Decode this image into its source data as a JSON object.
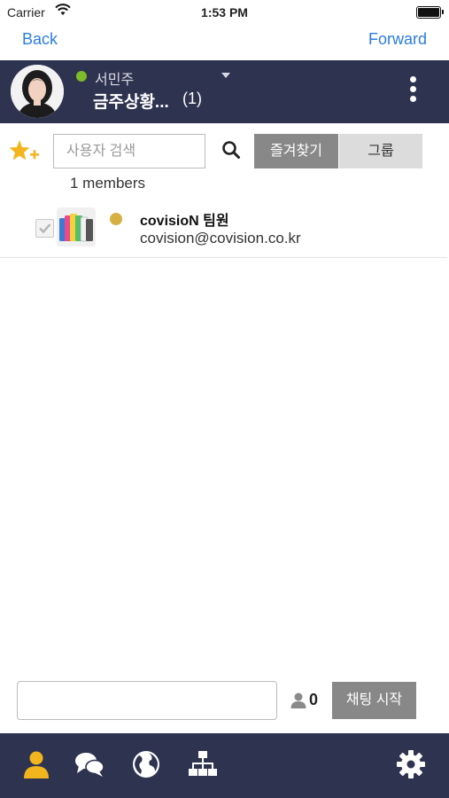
{
  "status_bar": {
    "carrier": "Carrier",
    "time": "1:53 PM"
  },
  "nav": {
    "back_label": "Back",
    "forward_label": "Forward"
  },
  "header": {
    "user_name": "서민주",
    "status_color": "#7cbb2a",
    "room_title": "금주상황...",
    "room_count": "(1)"
  },
  "search": {
    "placeholder": "사용자 검색",
    "tabs": [
      {
        "label": "즐겨찾기",
        "selected": true
      },
      {
        "label": "그룹",
        "selected": false
      }
    ]
  },
  "members_label": "1 members",
  "members": [
    {
      "name": "covisioN 팀원",
      "email": "covision@covision.co.kr",
      "presence_color": "#d6b043",
      "checked": true
    }
  ],
  "bottom": {
    "selected_count": "0",
    "start_chat_label": "채팅 시작"
  },
  "tab_bar": {
    "items": [
      {
        "icon": "person-icon",
        "active": true
      },
      {
        "icon": "chat-bubbles-icon",
        "active": false
      },
      {
        "icon": "globe-icon",
        "active": false
      },
      {
        "icon": "org-chart-icon",
        "active": false
      },
      {
        "icon": "gear-icon",
        "active": false
      }
    ],
    "active_color": "#f3b51e",
    "inactive_color": "#ffffff"
  }
}
